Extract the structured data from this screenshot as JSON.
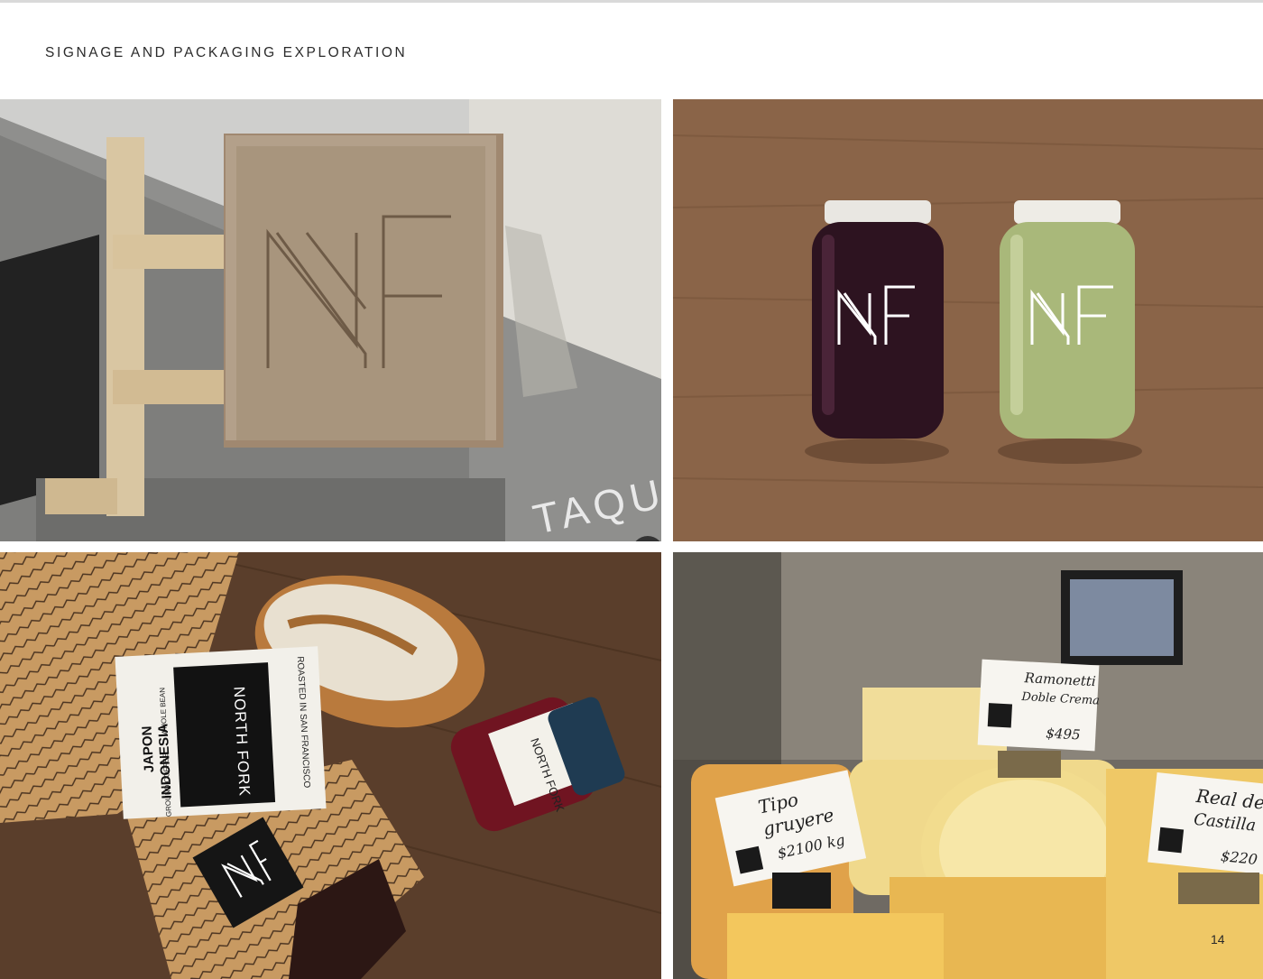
{
  "page": {
    "title": "SIGNAGE AND PACKAGING EXPLORATION",
    "page_number": "14"
  },
  "logo": {
    "mark": "NF"
  },
  "panels": {
    "sign": {
      "storefront_text": "TAQUER"
    },
    "jars": {},
    "bread": {
      "coffee_label": {
        "brand": "NORTH FORK",
        "roasted": "ROASTED IN SAN FRANCISCO",
        "ground": "GROUND COFFEE",
        "whole": "WHOLE BEAN",
        "origin_line1": "JAPON",
        "origin_line2": "INDONESIA"
      },
      "jam_label": {
        "brand": "NORTH FORK"
      }
    },
    "cheese": {
      "card1": {
        "line1": "Ramonetti",
        "line2": "Doble Crema",
        "price": "$495"
      },
      "card2": {
        "line1": "Tipo",
        "line2": "gruyere",
        "price": "$2100 kg"
      },
      "card3": {
        "line1": "Real de",
        "line2": "Castilla",
        "price": "$220"
      }
    }
  }
}
